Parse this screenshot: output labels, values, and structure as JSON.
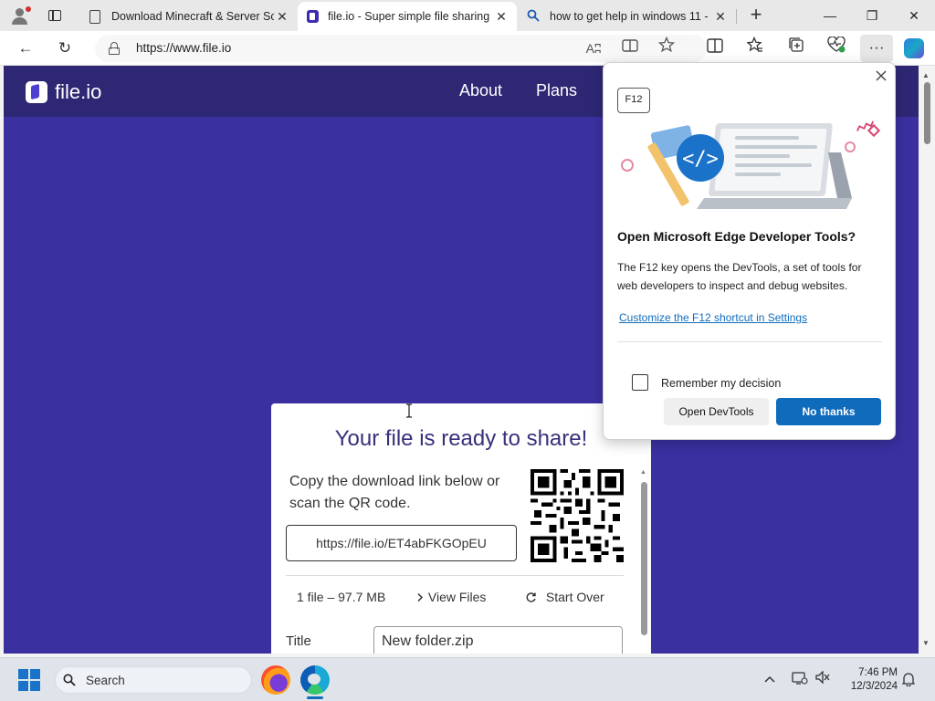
{
  "browser": {
    "tabs": [
      {
        "title": "Download Minecraft & Server Sof",
        "icon": "page-icon",
        "active": false
      },
      {
        "title": "file.io - Super simple file sharing",
        "icon": "fileio-favicon",
        "active": true
      },
      {
        "title": "how to get help in windows 11 - ",
        "icon": "search-icon",
        "active": false
      }
    ],
    "tab_close_glyph": "✕",
    "new_tab_glyph": "+",
    "window_controls": {
      "minimize": "—",
      "restore": "❐",
      "close": "✕"
    },
    "toolbar": {
      "back": "←",
      "refresh": "↻",
      "url": "https://www.file.io",
      "read_aloud": "Aʭ",
      "more": "···"
    }
  },
  "site": {
    "brand": "file.io",
    "nav": [
      "About",
      "Plans"
    ],
    "card": {
      "heading": "Your file is ready to share!",
      "description": "Copy the download link below or scan the QR code.",
      "link": "https://file.io/ET4abFKGOpEU",
      "file_info": "1 file – 97.7 MB",
      "view_files_label": "View Files",
      "start_over_label": "Start Over",
      "title_label": "Title",
      "title_value": "New folder.zip"
    }
  },
  "devtools_dialog": {
    "badge": "F12",
    "title": "Open Microsoft Edge Developer Tools?",
    "body": "The F12 key opens the DevTools, a set of tools for web developers to inspect and debug websites.",
    "link": "Customize the F12 shortcut in Settings",
    "checkbox_label": "Remember my decision",
    "checkbox_checked": false,
    "primary_button": "No thanks",
    "secondary_button": "Open DevTools",
    "accent_color": "#0f6cbd"
  },
  "taskbar": {
    "search_placeholder": "Search",
    "time": "7:46 PM",
    "date": "12/3/2024",
    "apps": [
      "firefox-icon",
      "edge-icon"
    ]
  },
  "colors": {
    "site_background": "#3b30a0",
    "site_header": "#2e2774",
    "heading_text": "#36317a"
  }
}
